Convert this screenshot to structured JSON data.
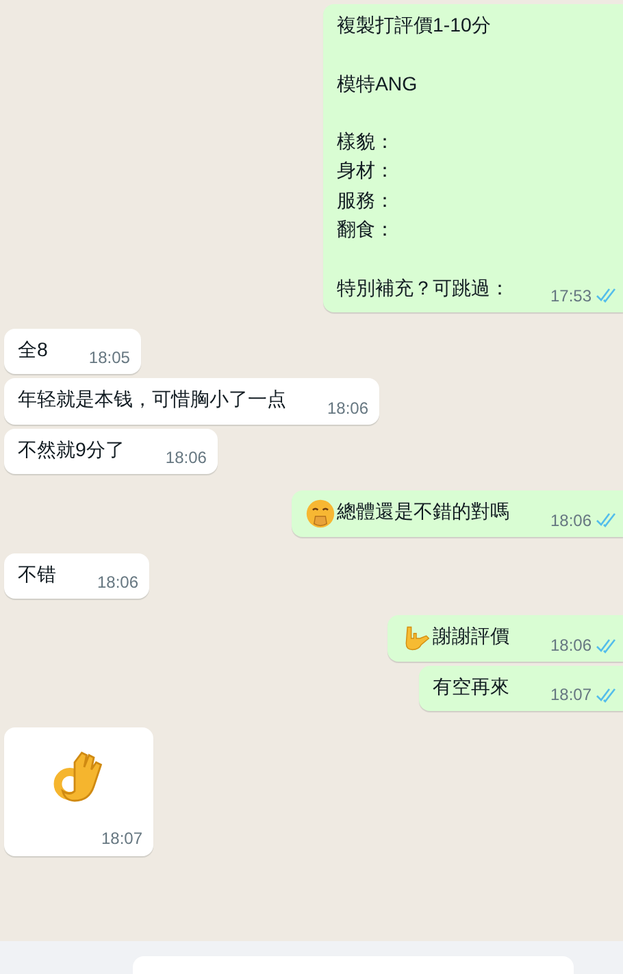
{
  "messages": [
    {
      "outgoing": true,
      "kind": "text",
      "paragraphs": [
        [
          "複製打評價1-10分"
        ],
        [
          "模特ANG"
        ],
        [
          "樣貌：",
          "身材：",
          "服務：",
          "翻食："
        ],
        [
          "特別補充？可跳過："
        ]
      ],
      "time": "17:53",
      "read": true
    },
    {
      "outgoing": false,
      "kind": "text",
      "text": "全8",
      "time": "18:05"
    },
    {
      "outgoing": false,
      "kind": "text",
      "text": "年轻就是本钱，可惜胸小了一点",
      "time": "18:06"
    },
    {
      "outgoing": false,
      "kind": "text",
      "text": "不然就9分了",
      "time": "18:06"
    },
    {
      "outgoing": true,
      "kind": "covered-smile",
      "text": "總體還是不錯的對嗎",
      "time": "18:06",
      "read": true
    },
    {
      "outgoing": false,
      "kind": "text",
      "text": "不错",
      "time": "18:06"
    },
    {
      "outgoing": true,
      "kind": "horns-hand",
      "text": "謝謝評價",
      "time": "18:06",
      "read": true
    },
    {
      "outgoing": true,
      "kind": "text",
      "text": "有空再來",
      "time": "18:07",
      "read": true
    },
    {
      "outgoing": false,
      "kind": "ok-hand",
      "time": "18:07"
    }
  ]
}
